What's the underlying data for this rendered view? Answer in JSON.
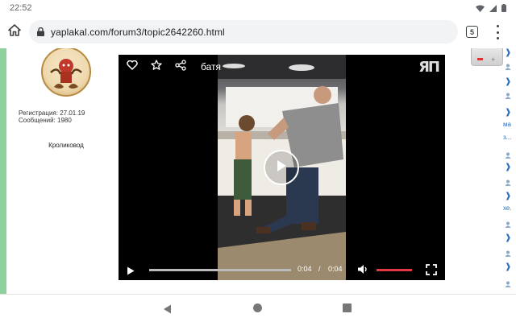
{
  "status": {
    "time": "22:52"
  },
  "browser": {
    "url": "yaplakal.com/forum3/topic2642260.html",
    "tab_count": "5"
  },
  "post": {
    "username": "Кроликовод",
    "registration": "Регистрация: 27.01.19",
    "messages": "Сообщений: 1980"
  },
  "player": {
    "title": "батя",
    "logo": "ЯП",
    "time_current": "0:04",
    "time_separator": "/",
    "time_total": "0:04",
    "progress_fraction": 1.0,
    "volume_fraction": 1.0,
    "accent_color": "#e2383f"
  },
  "right_strip": {
    "snippets": [
      "ма",
      "з...",
      "хе."
    ]
  },
  "icons": [
    "home-icon",
    "lock-icon",
    "heart-icon",
    "star-icon",
    "share-icon",
    "play-icon",
    "volume-icon",
    "fullscreen-icon",
    "wifi-icon",
    "signal-icon",
    "battery-icon",
    "nav-back-icon",
    "nav-home-icon",
    "nav-recent-icon"
  ]
}
